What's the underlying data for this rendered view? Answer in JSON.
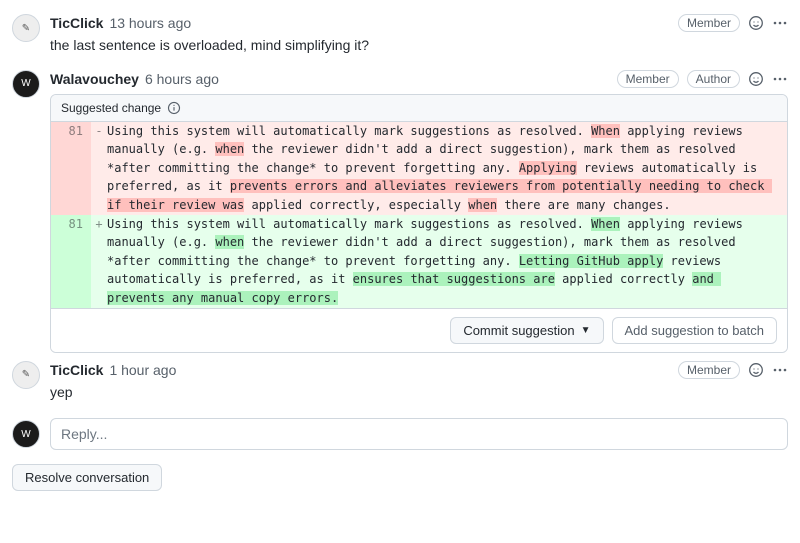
{
  "comments": [
    {
      "author": "TicClick",
      "time": "13 hours ago",
      "badges": {
        "member": "Member"
      },
      "text": "the last sentence is overloaded, mind simplifying it?"
    },
    {
      "author": "Walavouchey",
      "time": "6 hours ago",
      "badges": {
        "member": "Member",
        "author": "Author"
      },
      "suggestion": {
        "title": "Suggested change",
        "line_old": "81",
        "line_new": "81",
        "old_text": "Using this system will automatically mark suggestions as resolved. When applying reviews manually (e.g. when the reviewer didn't add a direct suggestion), mark them as resolved *after committing the change* to prevent forgetting any. Applying reviews automatically is preferred, as it prevents errors and alleviates reviewers from potentially needing to check if their review was applied correctly, especially when there are many changes.",
        "new_text": "Using this system will automatically mark suggestions as resolved. When applying reviews manually (e.g. when the reviewer didn't add a direct suggestion), mark them as resolved *after committing the change* to prevent forgetting any. Letting GitHub apply reviews automatically is preferred, as it ensures that suggestions are applied correctly and prevents any manual copy errors.",
        "old_highlights": [
          "When",
          "when",
          "Applying",
          "prevents errors and alleviates reviewers from potentially needing to check if their review was",
          ", especially when there are many changes."
        ],
        "new_highlights": [
          "When",
          "when",
          "Letting GitHub apply",
          "ensures that suggestions are",
          "and prevents any manual copy errors."
        ],
        "commit_label": "Commit suggestion",
        "batch_label": "Add suggestion to batch"
      }
    },
    {
      "author": "TicClick",
      "time": "1 hour ago",
      "badges": {
        "member": "Member"
      },
      "text": "yep"
    }
  ],
  "reply": {
    "placeholder": "Reply..."
  },
  "resolve_label": "Resolve conversation"
}
